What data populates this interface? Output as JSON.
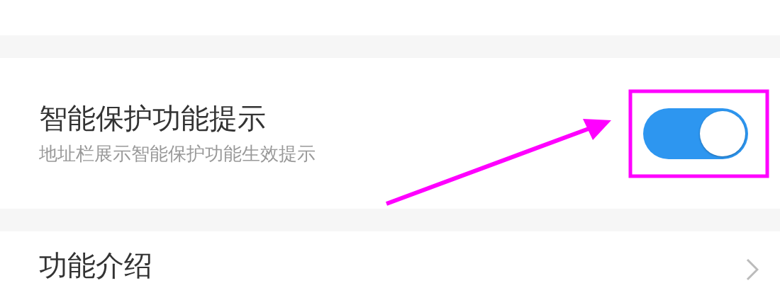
{
  "settings": [
    {
      "kind": "toggle",
      "title": "智能保护功能提示",
      "subtitle": "地址栏展示智能保护功能生效提示",
      "on": true
    },
    {
      "kind": "link",
      "title": "功能介绍"
    }
  ],
  "annotations": {
    "arrow": true,
    "highlight_box": true
  }
}
